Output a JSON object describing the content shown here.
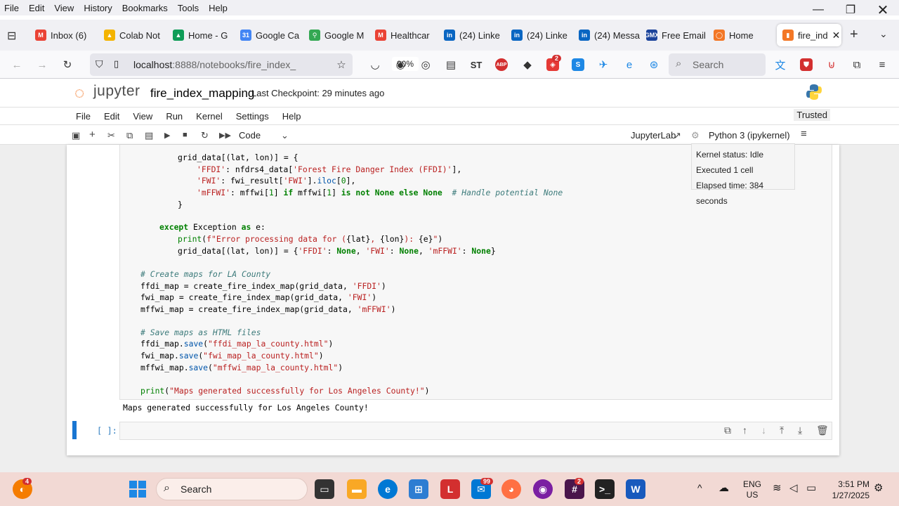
{
  "firefox": {
    "menu": [
      "File",
      "Edit",
      "View",
      "History",
      "Bookmarks",
      "Tools",
      "Help"
    ],
    "tabs": [
      {
        "label": "Inbox (6)",
        "icon": "gmail-icon",
        "color": "#ea4335",
        "letter": "M"
      },
      {
        "label": "Colab Not",
        "icon": "drive-icon",
        "color": "#f4b400",
        "letter": "▲"
      },
      {
        "label": "Home - G",
        "icon": "drive-icon",
        "color": "#0f9d58",
        "letter": "▲"
      },
      {
        "label": "Google Ca",
        "icon": "calendar-icon",
        "color": "#4285f4",
        "letter": "31"
      },
      {
        "label": "Google M",
        "icon": "maps-icon",
        "color": "#34a853",
        "letter": "⚲"
      },
      {
        "label": "Healthcar",
        "icon": "gmail-icon",
        "color": "#ea4335",
        "letter": "M"
      },
      {
        "label": "(24) Linke",
        "icon": "linkedin-icon",
        "color": "#0a66c2",
        "letter": "in"
      },
      {
        "label": "(24) Linke",
        "icon": "linkedin-icon",
        "color": "#0a66c2",
        "letter": "in"
      },
      {
        "label": "(24) Messa",
        "icon": "linkedin-icon",
        "color": "#0a66c2",
        "letter": "in"
      },
      {
        "label": "Free Email",
        "icon": "gmx-icon",
        "color": "#1c449b",
        "letter": "GMX"
      },
      {
        "label": "Home",
        "icon": "jupyter-icon",
        "color": "#f37726",
        "letter": "◯"
      }
    ],
    "active_tab": "fire_ind",
    "url_host": "localhost",
    "url_rest": ":8888/notebooks/fire_index_",
    "zoom": "90%",
    "search_placeholder": "Search"
  },
  "jupyter": {
    "logo_text": "jupyter",
    "notebook_name": "fire_index_mapping",
    "checkpoint": "Last Checkpoint: 29 minutes ago",
    "menu": [
      "File",
      "Edit",
      "View",
      "Run",
      "Kernel",
      "Settings",
      "Help"
    ],
    "trusted": "Trusted",
    "cell_type": "Code",
    "jupyterlab_link": "JupyterLab",
    "kernel_name": "Python 3 (ipykernel)",
    "tooltip": {
      "status": "Kernel status: Idle",
      "executed": "Executed 1 cell",
      "elapsed": "Elapsed time: 384 seconds"
    },
    "output": "Maps generated successfully for Los Angeles County!",
    "empty_prompt": "[ ]:"
  },
  "taskbar": {
    "search": "Search",
    "lang": "ENG",
    "region": "US",
    "time": "3:51 PM",
    "date": "1/27/2025",
    "badges": {
      "start": "4",
      "outlook": "99",
      "slack": "2"
    }
  }
}
